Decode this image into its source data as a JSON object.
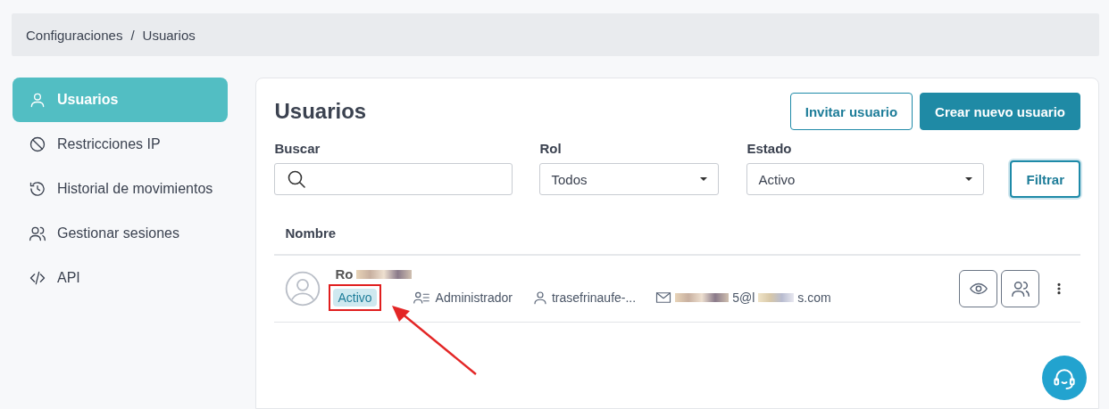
{
  "breadcrumb": {
    "items": [
      "Configuraciones",
      "Usuarios"
    ],
    "separator": "/"
  },
  "sidebar": {
    "items": [
      {
        "label": "Usuarios",
        "kind": "user",
        "selected": true
      },
      {
        "label": "Restricciones IP",
        "kind": "ban",
        "selected": false
      },
      {
        "label": "Historial de movimientos",
        "kind": "history",
        "selected": false
      },
      {
        "label": "Gestionar sesiones",
        "kind": "users",
        "selected": false
      },
      {
        "label": "API",
        "kind": "code",
        "selected": false
      }
    ]
  },
  "page": {
    "title": "Usuarios",
    "buttons": [
      {
        "label": "Invitar usuario",
        "kind": "outline"
      },
      {
        "label": "Crear nuevo usuario",
        "kind": "primary"
      }
    ]
  },
  "filters": {
    "search": {
      "label": "Buscar"
    },
    "role": {
      "label": "Rol",
      "value": "Todos"
    },
    "status": {
      "label": "Estado",
      "value": "Activo"
    },
    "button": "Filtrar"
  },
  "table": {
    "columns": [
      "Nombre"
    ],
    "rows": [
      {
        "name": "Ro",
        "status": "Activo",
        "status_highlighted": true,
        "role": "Administrador",
        "username": "trasefrinaufe-...",
        "email_parts": [
          "5@l",
          "s.com"
        ]
      }
    ]
  }
}
